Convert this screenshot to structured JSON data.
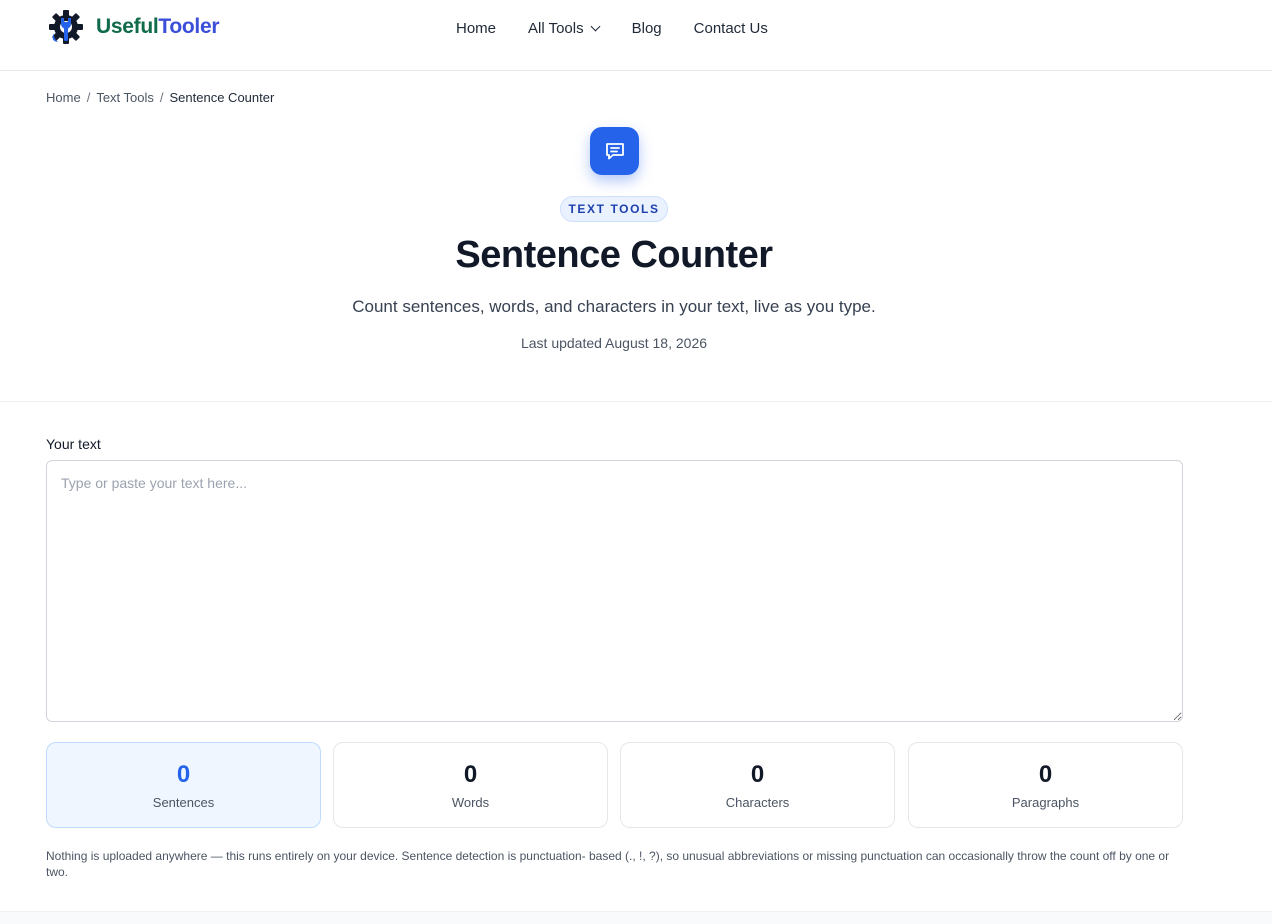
{
  "brand": {
    "name_part1": "Useful",
    "name_part2": "Tooler",
    "logo_icon": "gear-wrench-icon",
    "color_part1": "#0f6b4a",
    "color_part2": "#3b4fd8"
  },
  "nav": {
    "items": [
      {
        "label": "Home"
      },
      {
        "label": "All Tools"
      },
      {
        "label": "Blog"
      },
      {
        "label": "Contact Us"
      }
    ],
    "dropdown_icon": "chevron-down-icon"
  },
  "breadcrumb": {
    "items": [
      {
        "label": "Home"
      },
      {
        "label": "Text Tools"
      },
      {
        "label": "Sentence Counter"
      }
    ],
    "separator": "/"
  },
  "hero": {
    "icon": "chat-bubble-icon",
    "category": "TEXT TOOLS",
    "title": "Sentence Counter",
    "subtitle": "Count sentences, words, and characters in your text, live as you type.",
    "updated": "Last updated August 18, 2026",
    "accent_color": "#2563eb"
  },
  "editor": {
    "label": "Your text",
    "placeholder": "Type or paste your text here...",
    "value": ""
  },
  "stats": [
    {
      "value": "0",
      "label": "Sentences"
    },
    {
      "value": "0",
      "label": "Words"
    },
    {
      "value": "0",
      "label": "Characters"
    },
    {
      "value": "0",
      "label": "Paragraphs"
    }
  ],
  "note": "Nothing is uploaded anywhere — this runs entirely on your device. Sentence detection is punctuation- based (., !, ?), so unusual abbreviations or missing punctuation can occasionally throw the count off by one or two."
}
